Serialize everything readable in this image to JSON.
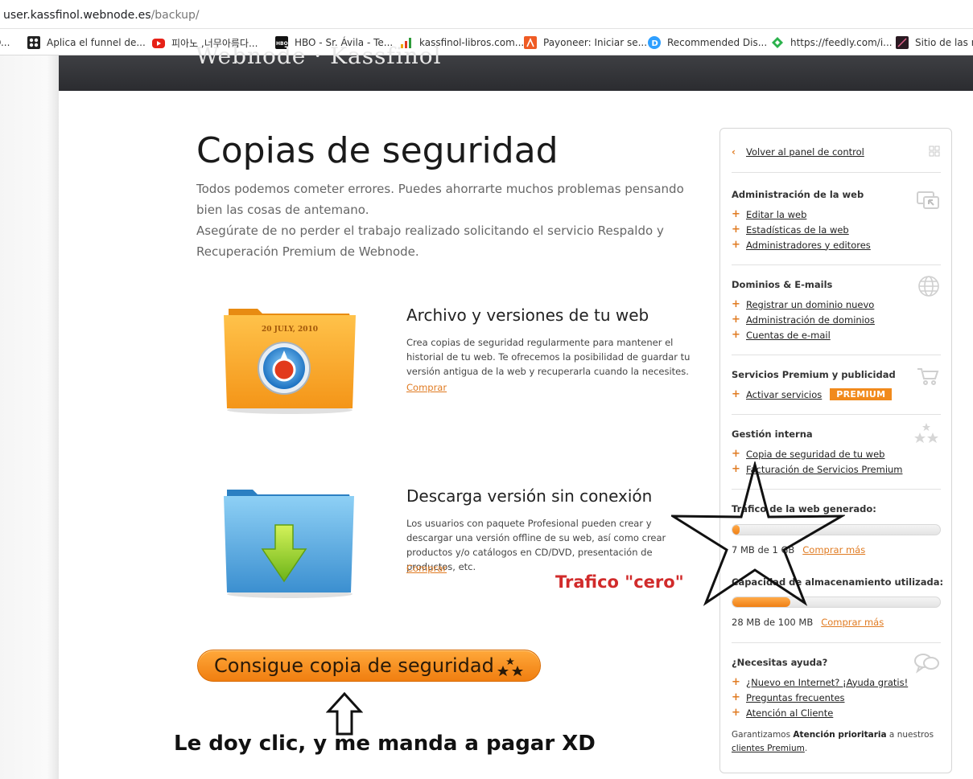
{
  "browser": {
    "url_host": "user.kassfinol.webnode.es",
    "url_path": "/backup/",
    "bookmarks": [
      {
        "label": "O...",
        "icon": "bookmark-icon"
      },
      {
        "label": "Aplica el funnel de...",
        "icon": "flower-icon",
        "color": "#222222"
      },
      {
        "label": "피아노 ,너무아름다...",
        "icon": "youtube-icon",
        "color": "#e62117"
      },
      {
        "label": "HBO - Sr. Ávila - Te...",
        "icon": "hbo-icon",
        "color": "#111111"
      },
      {
        "label": "kassfinol-libros.com...",
        "icon": "bars-icon",
        "color": "#2e9b3a"
      },
      {
        "label": "Payoneer: Iniciar se...",
        "icon": "payoneer-icon",
        "color": "#ef5b24"
      },
      {
        "label": "Recommended Dis...",
        "icon": "disqus-icon",
        "color": "#2e9fff"
      },
      {
        "label": "https://feedly.com/i...",
        "icon": "feedly-icon",
        "color": "#2bb24c"
      },
      {
        "label": "Sitio de las no",
        "icon": "site-icon",
        "color": "#6a1e3a"
      }
    ]
  },
  "header": {
    "logo_text": "Webnode · Kassfinol"
  },
  "main": {
    "title": "Copias de seguridad",
    "intro_1": "Todos podemos cometer errores. Puedes ahorrarte muchos problemas pensando bien las cosas de antemano.",
    "intro_2": "Asegúrate de no perder el trabajo realizado solicitando el servicio Respaldo y Recuperación Premium de Webnode.",
    "features": [
      {
        "title": "Archivo y versiones de tu web",
        "desc": "Crea copias de seguridad regularmente para mantener el historial de tu web. Te ofrecemos la posibilidad de guardar tu versión antigua de la web y recuperarla cuando la necesites.",
        "link": "Comprar",
        "folder_date": "20 JULY, 2010"
      },
      {
        "title": "Descarga versión sin conexión",
        "desc": "Los usuarios con paquete Profesional pueden crear y descargar una versión offline de su web, así como crear productos y/o catálogos en CD/DVD, presentación de productos, etc.",
        "link": "Comprar"
      }
    ],
    "cta_label": "Consigue copia de seguridad"
  },
  "annotations": {
    "bottom": "Le doy clic, y me manda a pagar XD",
    "traffic": "Trafico \"cero\""
  },
  "sidebar": {
    "back": "Volver al panel de control",
    "sections": [
      {
        "title": "Administración de la web",
        "items": [
          "Editar la web",
          "Estadísticas de la web",
          "Administradores y editores"
        ]
      },
      {
        "title": "Dominios & E-mails",
        "items": [
          "Registrar un dominio nuevo",
          "Administración de dominios",
          "Cuentas de e-mail"
        ]
      },
      {
        "title": "Servicios Premium y publicidad",
        "items": [
          "Activar servicios"
        ],
        "badge": "PREMIUM"
      },
      {
        "title": "Gestión interna",
        "items": [
          "Copia de seguridad de tu web",
          "Facturación de Servicios Premium"
        ]
      }
    ],
    "traffic": {
      "title": "Tráfico de la web generado:",
      "text": "7 MB de 1 GB",
      "more": "Comprar más",
      "fraction": 0.007
    },
    "storage": {
      "title": "Capacidad de almacenamiento utilizada:",
      "text": "28 MB de 100 MB",
      "more": "Comprar más",
      "fraction": 0.28
    },
    "help": {
      "title": "¿Necesitas ayuda?",
      "items": [
        "¿Nuevo en Internet? ¡Ayuda gratis!",
        "Preguntas frecuentes",
        "Atención al Cliente"
      ]
    },
    "footer": {
      "pre": "Garantizamos ",
      "bold": "Atención prioritaria",
      "mid": " a nuestros ",
      "link": "clientes Premium",
      "end": "."
    }
  },
  "colors": {
    "accent": "#e07b22",
    "header": "#2f3034",
    "annotation_red": "#d12b2b"
  }
}
